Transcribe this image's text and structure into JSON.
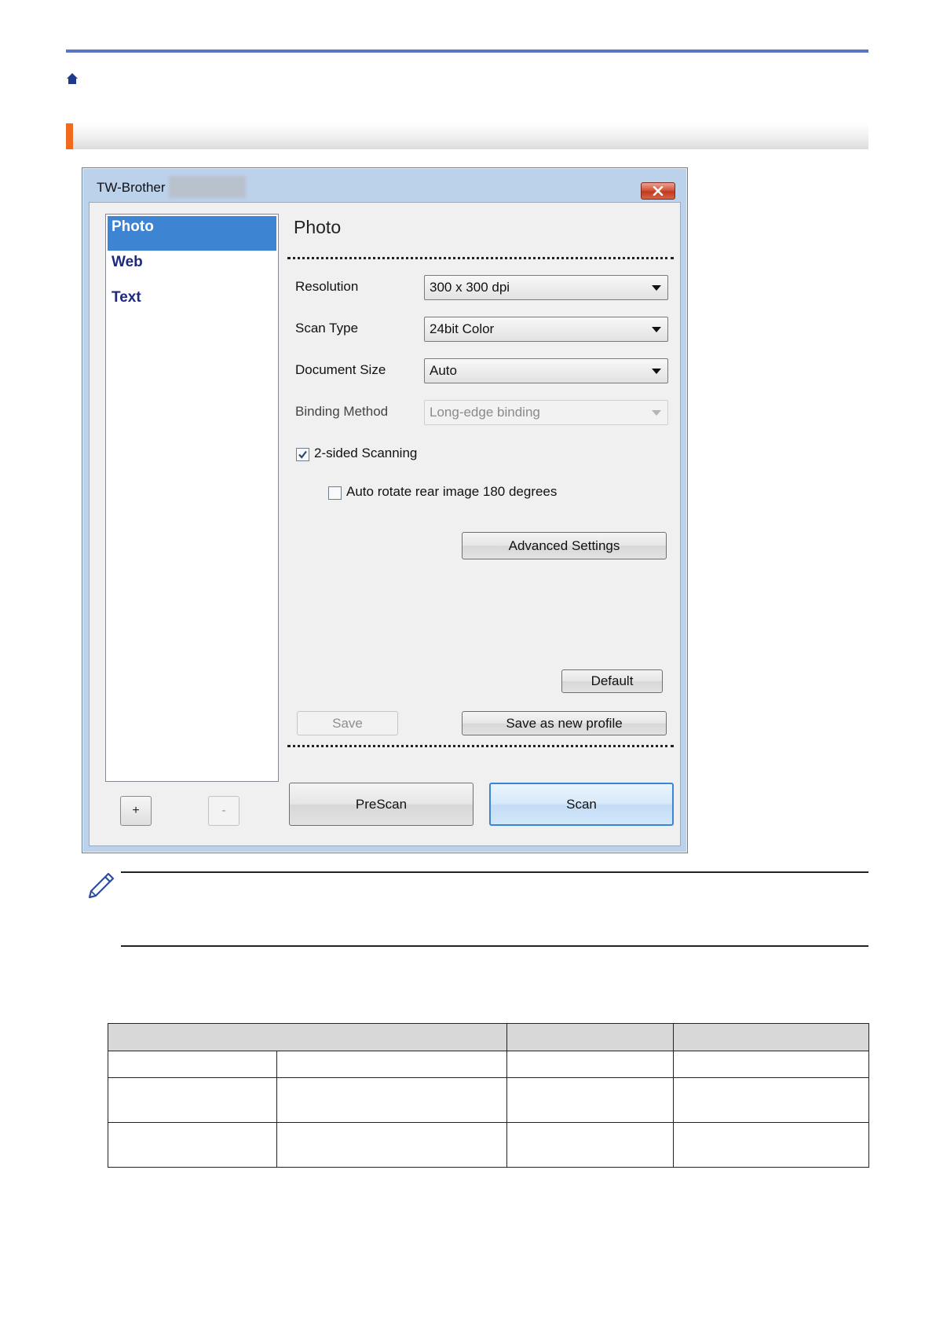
{
  "dialog": {
    "title": "TW-Brother",
    "profiles": [
      {
        "label": "Photo",
        "selected": true
      },
      {
        "label": "Web",
        "selected": false
      },
      {
        "label": "Text",
        "selected": false
      }
    ],
    "add_label": "+",
    "remove_label": "-",
    "panel_title": "Photo",
    "fields": {
      "resolution": {
        "label": "Resolution",
        "value": "300 x 300 dpi"
      },
      "scan_type": {
        "label": "Scan Type",
        "value": "24bit Color"
      },
      "document_size": {
        "label": "Document Size",
        "value": "Auto"
      },
      "binding_method": {
        "label": "Binding Method",
        "value": "Long-edge binding"
      }
    },
    "two_sided": {
      "label": "2-sided Scanning",
      "checked": true
    },
    "auto_rotate": {
      "label": "Auto rotate rear image 180 degrees",
      "checked": false
    },
    "advanced_label": "Advanced Settings",
    "default_label": "Default",
    "save_label": "Save",
    "save_new_label": "Save as new profile",
    "prescan_label": "PreScan",
    "scan_label": "Scan"
  },
  "colors": {
    "accent_orange": "#f26a1b",
    "rule_blue": "#5b74c4",
    "selection_blue": "#3d84d3"
  }
}
